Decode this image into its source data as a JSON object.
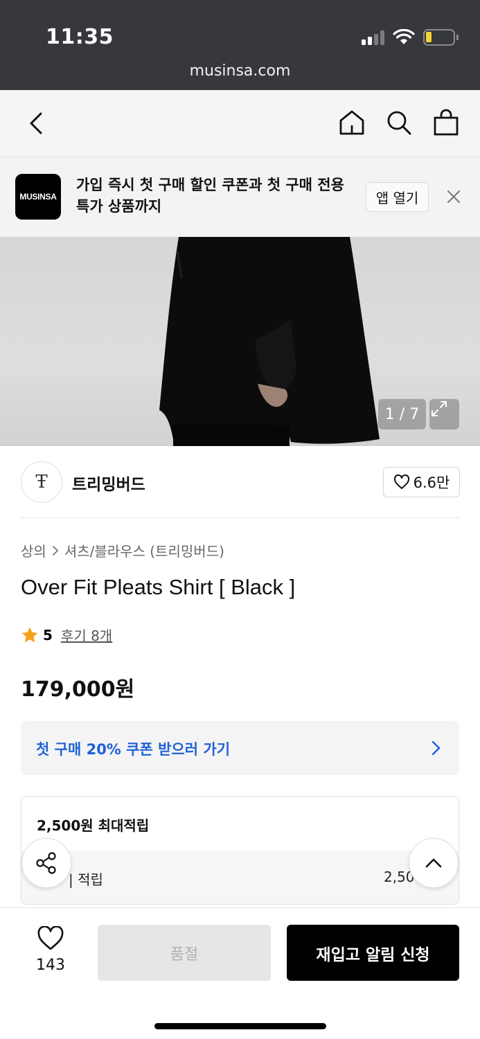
{
  "status_bar": {
    "time": "11:35",
    "url": "musinsa.com",
    "icons": [
      "cellular-signal-icon",
      "wifi-icon",
      "battery-low-icon"
    ],
    "battery_color": "#f6d438"
  },
  "nav": {
    "icons": [
      "back-chevron-icon",
      "home-icon",
      "search-icon",
      "shopping-bag-icon"
    ]
  },
  "app_banner": {
    "logo_text": "MUSINSA",
    "message": "가입 즉시 첫 구매 할인 쿠폰과 첫 구매 전용 특가 상품까지",
    "open_label": "앱 열기",
    "close_icon": "close-icon"
  },
  "gallery": {
    "counter": "1 / 7",
    "expand_icon": "expand-icon"
  },
  "brand": {
    "logo_text": "Ŧ",
    "name": "트리밍버드",
    "likes": "6.6만",
    "like_icon": "heart-outline-icon"
  },
  "product": {
    "breadcrumb": [
      "상의",
      "셔츠/블라우스 (트리밍버드)"
    ],
    "title": "Over Fit Pleats Shirt [ Black ]",
    "rating": "5",
    "review_link": "후기 8개",
    "price": "179,000원",
    "star_color": "#f7a21b"
  },
  "coupon": {
    "label": "첫 구매 20% 쿠폰 받으러 가기",
    "color": "#1f61d6"
  },
  "points": {
    "title": "2,500원 최대적립",
    "row_label": "| 적립",
    "row_value": "2,50"
  },
  "bottom_bar": {
    "wish_count": "143",
    "soldout_label": "품절",
    "restock_label": "재입고 알림 신청"
  }
}
